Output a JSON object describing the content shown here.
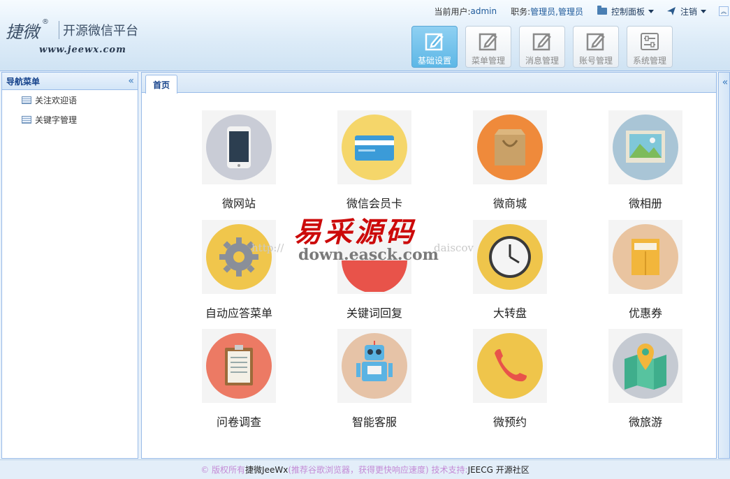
{
  "header": {
    "logo_text": "捷微",
    "logo_reg": "®",
    "logo_subtitle": "开源微信平台",
    "logo_url": "www.jeewx.com",
    "current_user_label": "当前用户: ",
    "current_user": "admin",
    "role_label": "职务: ",
    "role": "管理员,管理员",
    "control_panel": "控制面板",
    "logout": "注销"
  },
  "nav_buttons": [
    {
      "label": "基础设置",
      "icon": "edit-icon",
      "active": true
    },
    {
      "label": "菜单管理",
      "icon": "edit-icon",
      "active": false
    },
    {
      "label": "消息管理",
      "icon": "edit-icon",
      "active": false
    },
    {
      "label": "账号管理",
      "icon": "edit-icon",
      "active": false
    },
    {
      "label": "系统管理",
      "icon": "sliders-icon",
      "active": false
    }
  ],
  "sidebar": {
    "title": "导航菜单",
    "collapse": "«",
    "items": [
      {
        "label": "关注欢迎语",
        "icon": "table-icon"
      },
      {
        "label": "关键字管理",
        "icon": "table-icon"
      }
    ]
  },
  "tabs": [
    {
      "label": "首页"
    }
  ],
  "tiles": [
    {
      "label": "微网站",
      "icon": "phone-icon",
      "color": "#c9ccd6"
    },
    {
      "label": "微信会员卡",
      "icon": "card-icon",
      "color": "#f5d66a"
    },
    {
      "label": "微商城",
      "icon": "shopping-bag-icon",
      "color": "#ef8a3b"
    },
    {
      "label": "微相册",
      "icon": "photo-icon",
      "color": "#a9c5d6"
    },
    {
      "label": "自动应答菜单",
      "icon": "gear-icon",
      "color": "#f0c64c"
    },
    {
      "label": "关键词回复",
      "icon": "chat-bubble-icon",
      "color": "#e8534a"
    },
    {
      "label": "大转盘",
      "icon": "clock-icon",
      "color": "#efc54b"
    },
    {
      "label": "优惠券",
      "icon": "envelope-icon",
      "color": "#e9c4a0"
    },
    {
      "label": "问卷调查",
      "icon": "clipboard-icon",
      "color": "#ec7a64"
    },
    {
      "label": "智能客服",
      "icon": "robot-icon",
      "color": "#e6c3a7"
    },
    {
      "label": "微预约",
      "icon": "phone-handset-icon",
      "color": "#efc54b"
    },
    {
      "label": "微旅游",
      "icon": "map-icon",
      "color": "#c5cad2"
    }
  ],
  "watermark": {
    "cn": "易采源码",
    "en": "down.easck.com",
    "faint_left": "http://",
    "faint_right": "daiscov"
  },
  "east_panel": {
    "expand": "«"
  },
  "footer": {
    "copyright": "© 版权所有 ",
    "brand": "捷微JeeWx",
    "note": " (推荐谷歌浏览器，获得更快响应速度) 技术支持:",
    "support": "JEECG 开源社区"
  }
}
